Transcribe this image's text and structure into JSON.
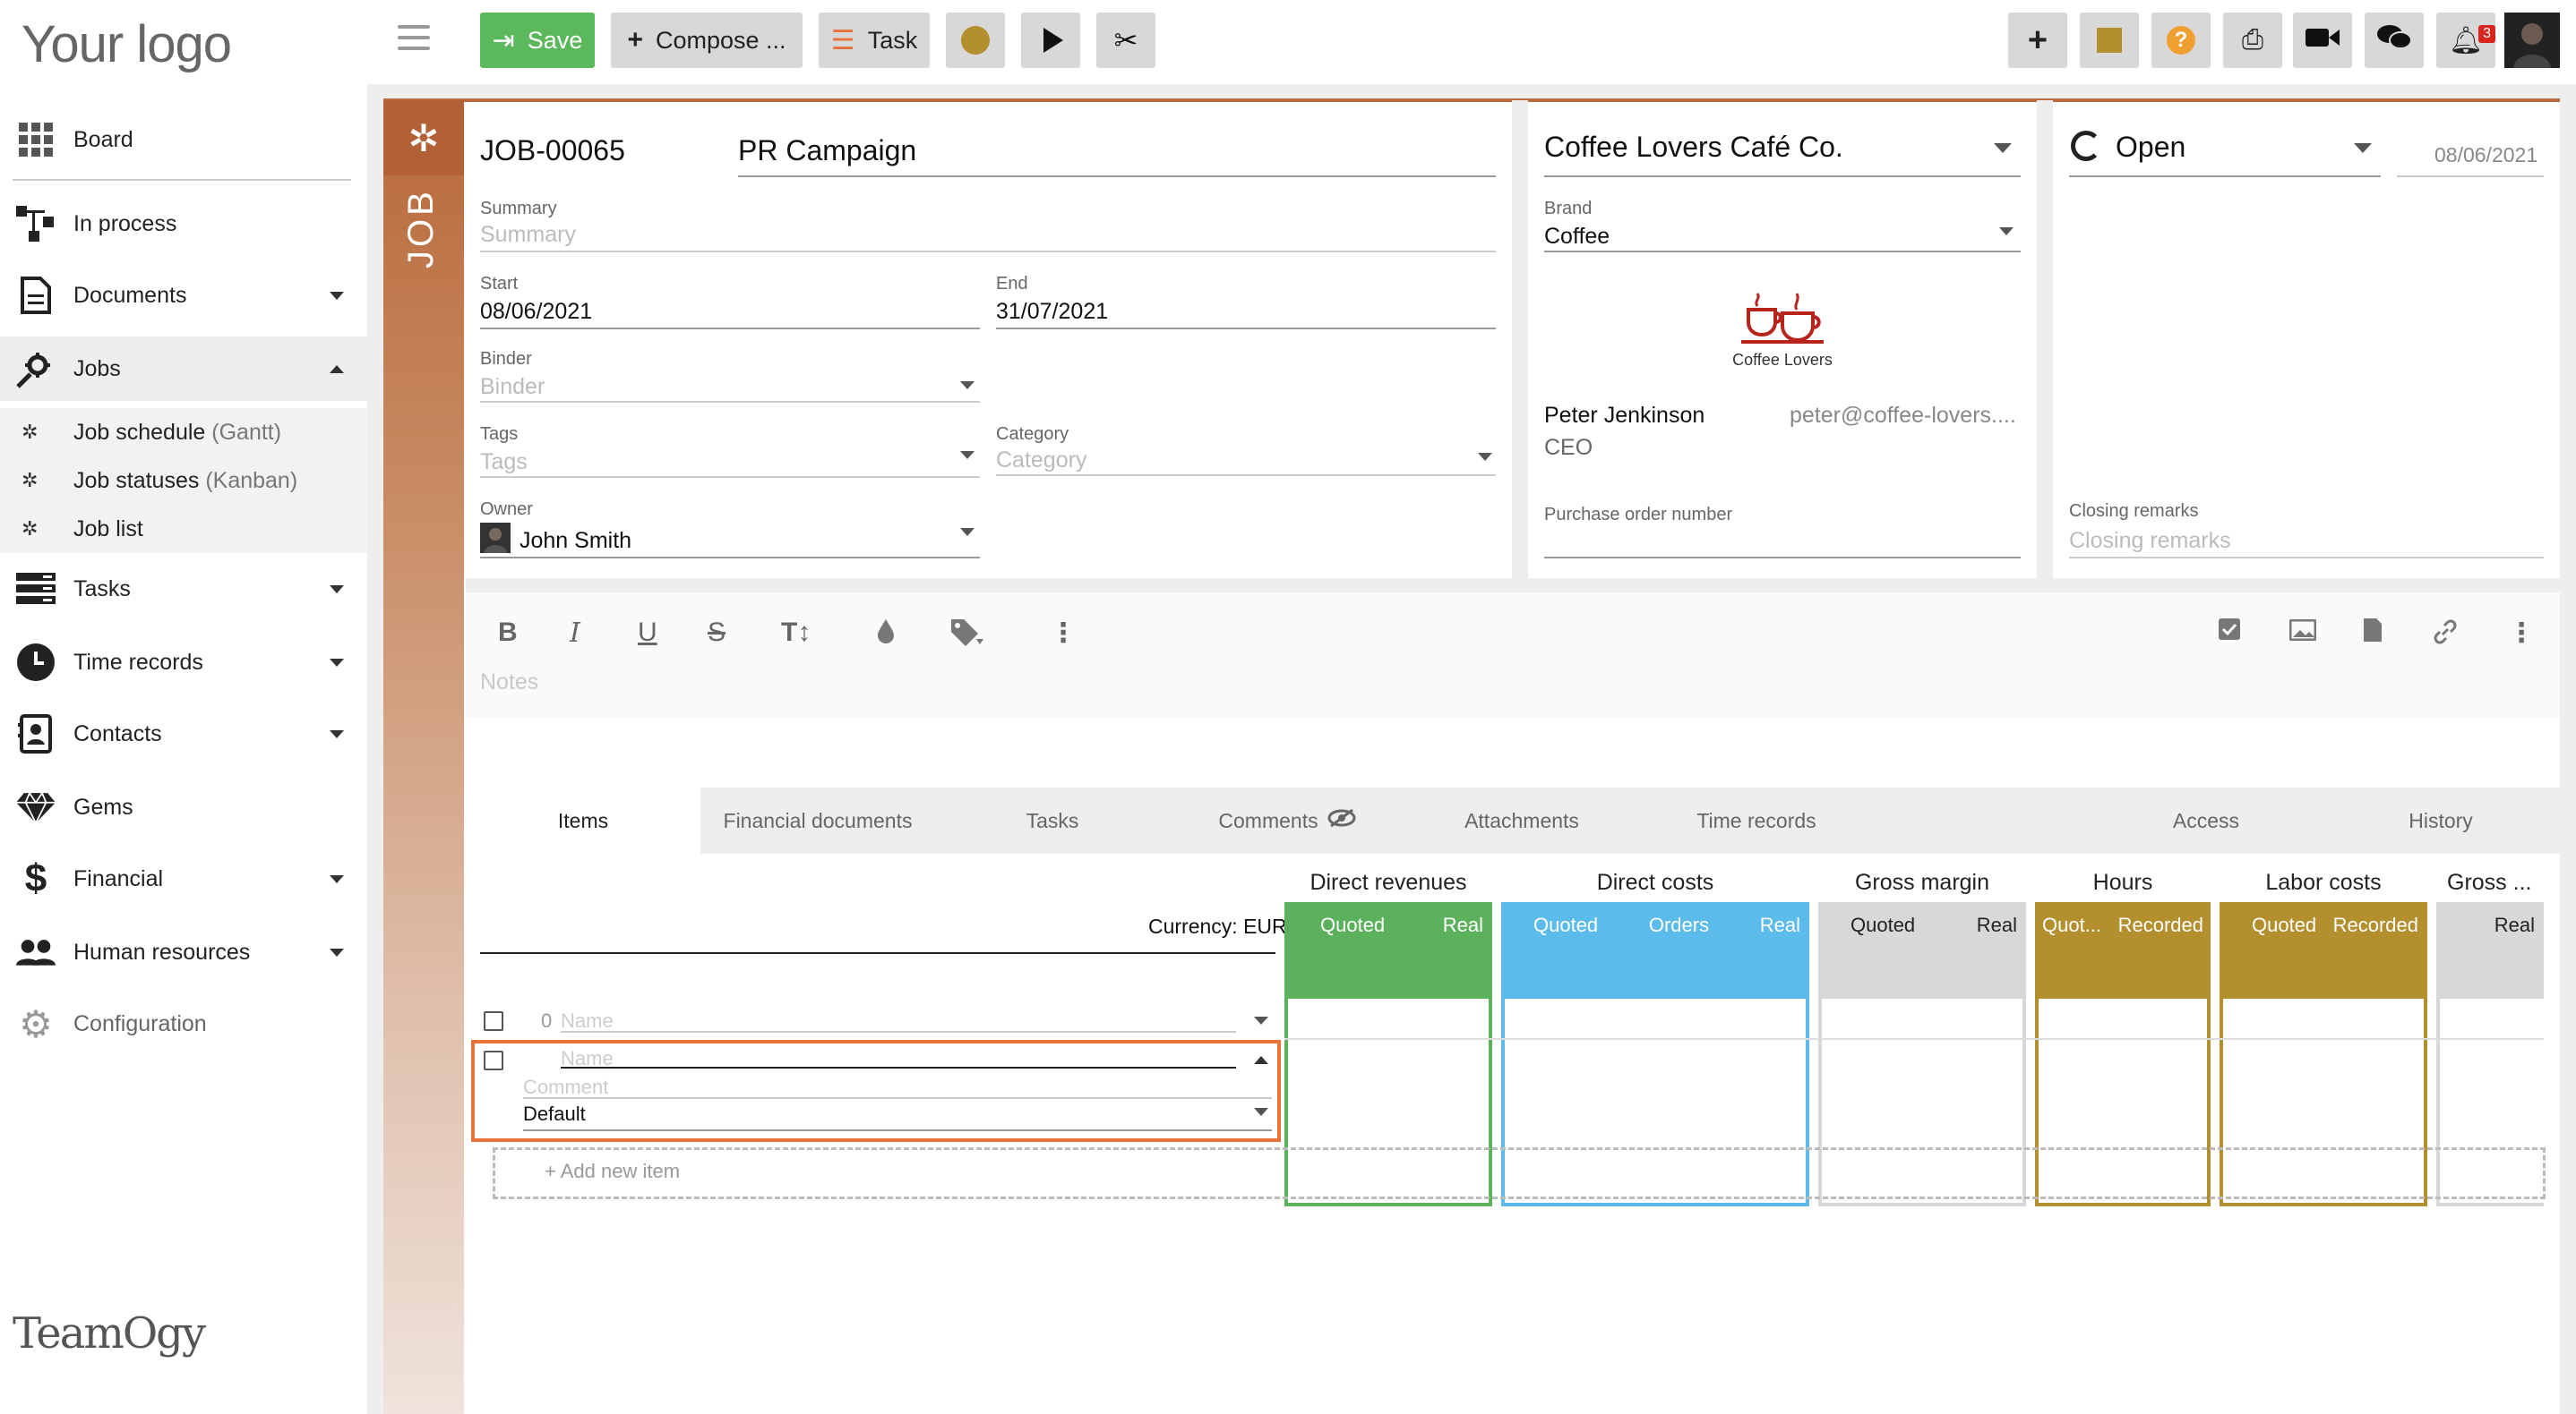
{
  "logo": "Your logo",
  "brand_logo": "TeamOgy",
  "sidebar": {
    "items": [
      {
        "label": "Board"
      },
      {
        "label": "In process"
      },
      {
        "label": "Documents"
      },
      {
        "label": "Jobs"
      },
      {
        "label": "Tasks"
      },
      {
        "label": "Time records"
      },
      {
        "label": "Contacts"
      },
      {
        "label": "Gems"
      },
      {
        "label": "Financial"
      },
      {
        "label": "Human resources"
      },
      {
        "label": "Configuration"
      }
    ],
    "subitems": [
      {
        "label": "Job schedule",
        "hint": "(Gantt)"
      },
      {
        "label": "Job statuses",
        "hint": "(Kanban)"
      },
      {
        "label": "Job list",
        "hint": ""
      }
    ]
  },
  "toolbar": {
    "save_label": "Save",
    "compose_label": "Compose ...",
    "task_label": "Task",
    "notification_count": "3"
  },
  "job": {
    "band_label": "JOB",
    "number": "JOB-00065",
    "title": "PR Campaign",
    "summary_label": "Summary",
    "summary_placeholder": "Summary",
    "start_label": "Start",
    "start_value": "08/06/2021",
    "end_label": "End",
    "end_value": "31/07/2021",
    "binder_label": "Binder",
    "binder_placeholder": "Binder",
    "tags_label": "Tags",
    "tags_placeholder": "Tags",
    "category_label": "Category",
    "category_placeholder": "Category",
    "owner_label": "Owner",
    "owner_value": "John Smith"
  },
  "client": {
    "name": "Coffee Lovers Café Co.",
    "brand_label": "Brand",
    "brand_value": "Coffee",
    "logo_caption": "Coffee Lovers",
    "contact_name": "Peter Jenkinson",
    "contact_email": "peter@coffee-lovers....",
    "contact_role": "CEO",
    "po_label": "Purchase order number"
  },
  "status": {
    "value": "Open",
    "date": "08/06/2021",
    "closing_label": "Closing remarks",
    "closing_placeholder": "Closing remarks"
  },
  "editor": {
    "notes_placeholder": "Notes"
  },
  "tabs": [
    {
      "label": "Items"
    },
    {
      "label": "Financial documents"
    },
    {
      "label": "Tasks"
    },
    {
      "label": "Comments"
    },
    {
      "label": "Attachments"
    },
    {
      "label": "Time records"
    },
    {
      "label": "Access"
    },
    {
      "label": "History"
    }
  ],
  "grid": {
    "currency": "Currency: EUR",
    "groups": [
      {
        "title": "Direct revenues",
        "subs": [
          "Quoted",
          "Real"
        ],
        "color": "#5cb15c"
      },
      {
        "title": "Direct costs",
        "subs": [
          "Quoted",
          "Orders",
          "Real"
        ],
        "color": "#5bbbea"
      },
      {
        "title": "Gross margin",
        "subs": [
          "Quoted",
          "Real"
        ],
        "color": "#d8d8d8"
      },
      {
        "title": "Hours",
        "subs": [
          "Quot...",
          "Recorded"
        ],
        "color": "#b38f2e"
      },
      {
        "title": "Labor costs",
        "subs": [
          "Quoted",
          "Recorded"
        ],
        "color": "#b38f2e"
      },
      {
        "title": "Gross ...",
        "subs": [
          "Real"
        ],
        "color": "#d8d8d8"
      }
    ],
    "row1_index": "0",
    "name_placeholder": "Name",
    "comment_placeholder": "Comment",
    "default_value": "Default",
    "add_item": "+ Add new item"
  }
}
